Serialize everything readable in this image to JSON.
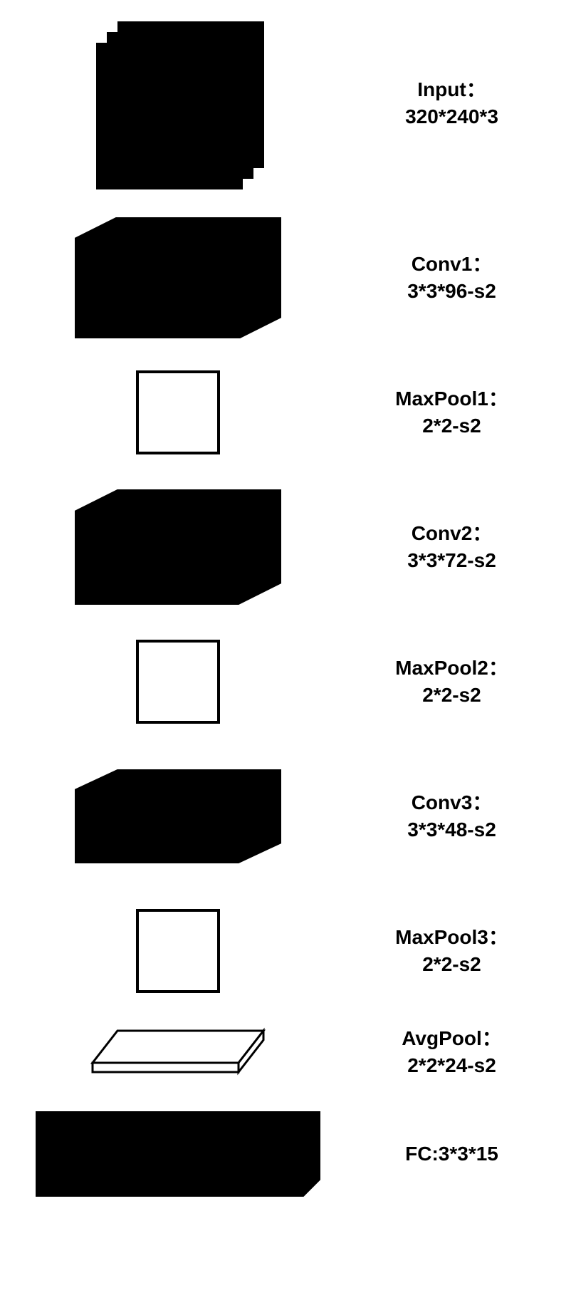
{
  "layers": [
    {
      "title": "Input：",
      "params": "320*240*3"
    },
    {
      "title": "Conv1：",
      "params": "3*3*96-s2"
    },
    {
      "title": "MaxPool1：",
      "params": "2*2-s2"
    },
    {
      "title": "Conv2：",
      "params": "3*3*72-s2"
    },
    {
      "title": "MaxPool2：",
      "params": "2*2-s2"
    },
    {
      "title": "Conv3：",
      "params": "3*3*48-s2"
    },
    {
      "title": "MaxPool3：",
      "params": "2*2-s2"
    },
    {
      "title": "AvgPool：",
      "params": "2*2*24-s2"
    },
    {
      "title": "FC:3*3*15",
      "params": ""
    }
  ]
}
